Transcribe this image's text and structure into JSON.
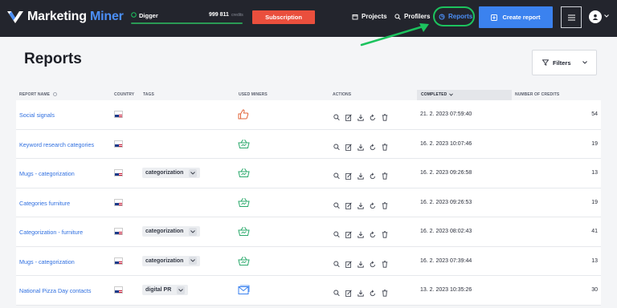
{
  "app": {
    "brand_primary": "Marketing",
    "brand_secondary": "Miner",
    "plan_name": "Digger",
    "credits_value": "999 811",
    "credits_label": "credits",
    "subscription_label": "Subscription"
  },
  "nav": {
    "projects": "Projects",
    "profilers": "Profilers",
    "reports": "Reports",
    "create_report": "Create report"
  },
  "colors": {
    "topbar": "#23252d",
    "accent_blue": "#3b82ef",
    "subscription_red": "#ea4f3d",
    "highlight_green": "#1cc35e"
  },
  "page": {
    "title": "Reports",
    "filters_label": "Filters"
  },
  "table": {
    "headers": {
      "report_name": "REPORT NAME",
      "country": "COUNTRY",
      "tags": "TAGS",
      "used_miners": "USED MINERS",
      "actions": "ACTIONS",
      "completed": "COMPLETED",
      "credits": "NUMBER OF CREDITS"
    },
    "rows": [
      {
        "name": "Social signals",
        "country": "us-flag",
        "tag": "",
        "miner": "thumbs-up-icon",
        "completed": "21. 2. 2023 07:59:40",
        "credits": "54"
      },
      {
        "name": "Keyword research categories",
        "country": "us-flag",
        "tag": "",
        "miner": "cart-icon",
        "completed": "16. 2. 2023 10:07:46",
        "credits": "19"
      },
      {
        "name": "Mugs - categorization",
        "country": "us-flag",
        "tag": "categorization",
        "miner": "cart-icon",
        "completed": "16. 2. 2023 09:26:58",
        "credits": "13"
      },
      {
        "name": "Categories furniture",
        "country": "us-flag",
        "tag": "",
        "miner": "cart-icon",
        "completed": "16. 2. 2023 09:26:53",
        "credits": "19"
      },
      {
        "name": "Categorization - furniture",
        "country": "us-flag",
        "tag": "categorization",
        "miner": "cart-icon",
        "completed": "16. 2. 2023 08:02:43",
        "credits": "41"
      },
      {
        "name": "Mugs - categorization",
        "country": "us-flag",
        "tag": "categorization",
        "miner": "cart-icon",
        "completed": "16. 2. 2023 07:39:44",
        "credits": "13"
      },
      {
        "name": "National Pizza Day contacts",
        "country": "us-flag",
        "tag": "digital PR",
        "miner": "mail-icon",
        "completed": "13. 2. 2023 10:35:26",
        "credits": "30"
      }
    ]
  }
}
